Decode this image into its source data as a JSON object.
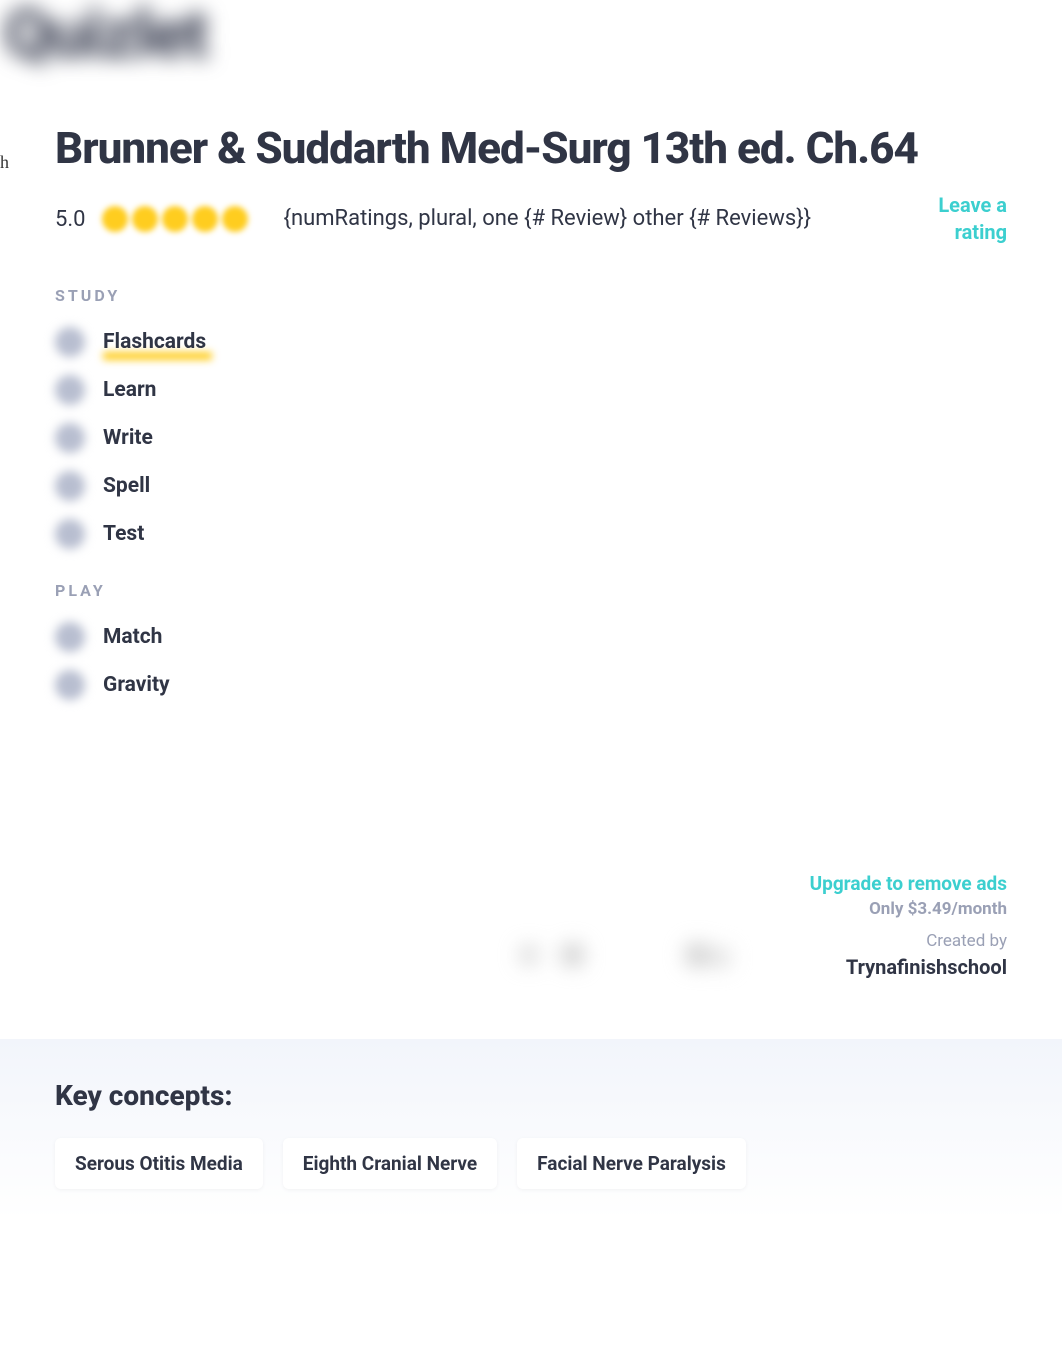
{
  "logo_text": "Quizlet",
  "stray_char": "h",
  "title": "Brunner & Suddarth Med-Surg 13th ed. Ch.64",
  "rating": {
    "value": "5.0",
    "reviews_template": "{numRatings, plural, one {# Review} other {# Reviews}}",
    "leave_label": "Leave a rating"
  },
  "study": {
    "label": "STUDY",
    "modes": [
      {
        "label": "Flashcards",
        "active": true
      },
      {
        "label": "Learn",
        "active": false
      },
      {
        "label": "Write",
        "active": false
      },
      {
        "label": "Spell",
        "active": false
      },
      {
        "label": "Test",
        "active": false
      }
    ]
  },
  "play": {
    "label": "PLAY",
    "modes": [
      {
        "label": "Match"
      },
      {
        "label": "Gravity"
      }
    ]
  },
  "upgrade": {
    "link": "Upgrade to remove ads",
    "price": "Only $3.49/month"
  },
  "creator": {
    "created_by_label": "Created by",
    "name": "Trynafinishschool"
  },
  "key_concepts": {
    "title": "Key concepts:",
    "chips": [
      "Serous Otitis Media",
      "Eighth Cranial Nerve",
      "Facial Nerve Paralysis"
    ]
  }
}
